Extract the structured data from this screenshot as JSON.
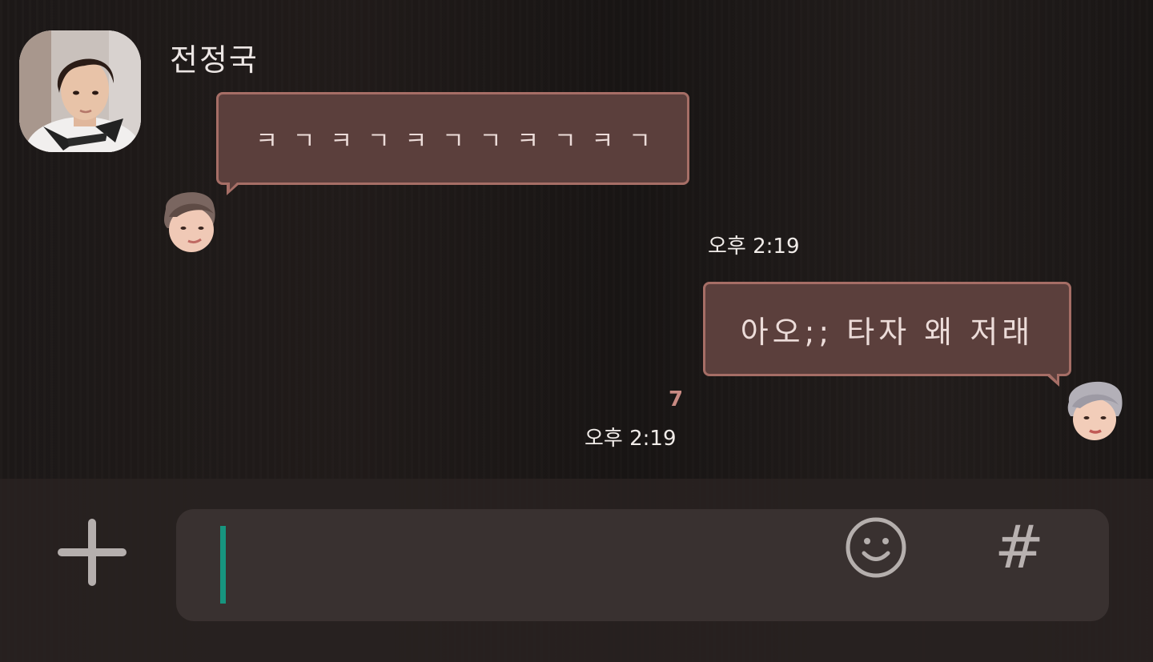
{
  "chat": {
    "sender_name": "전정국",
    "messages": [
      {
        "direction": "incoming",
        "text": "ㅋㄱㅋㄱㅋㄱㄱㅋㄱㅋㄱ",
        "time": "오후 2:19"
      },
      {
        "direction": "outgoing",
        "text": "아오;; 타자 왜 저래",
        "time": "오후 2:19",
        "unread_count": "7"
      }
    ]
  },
  "input_bar": {
    "message_value": "",
    "plus_icon": "plus-icon",
    "emoji_icon": "smiley-icon",
    "hash_label": "#",
    "caret_color": "#17957f"
  },
  "colors": {
    "bubble_fill": "#5b3f3c",
    "bubble_border": "#a66e66",
    "background": "#1d1918"
  }
}
